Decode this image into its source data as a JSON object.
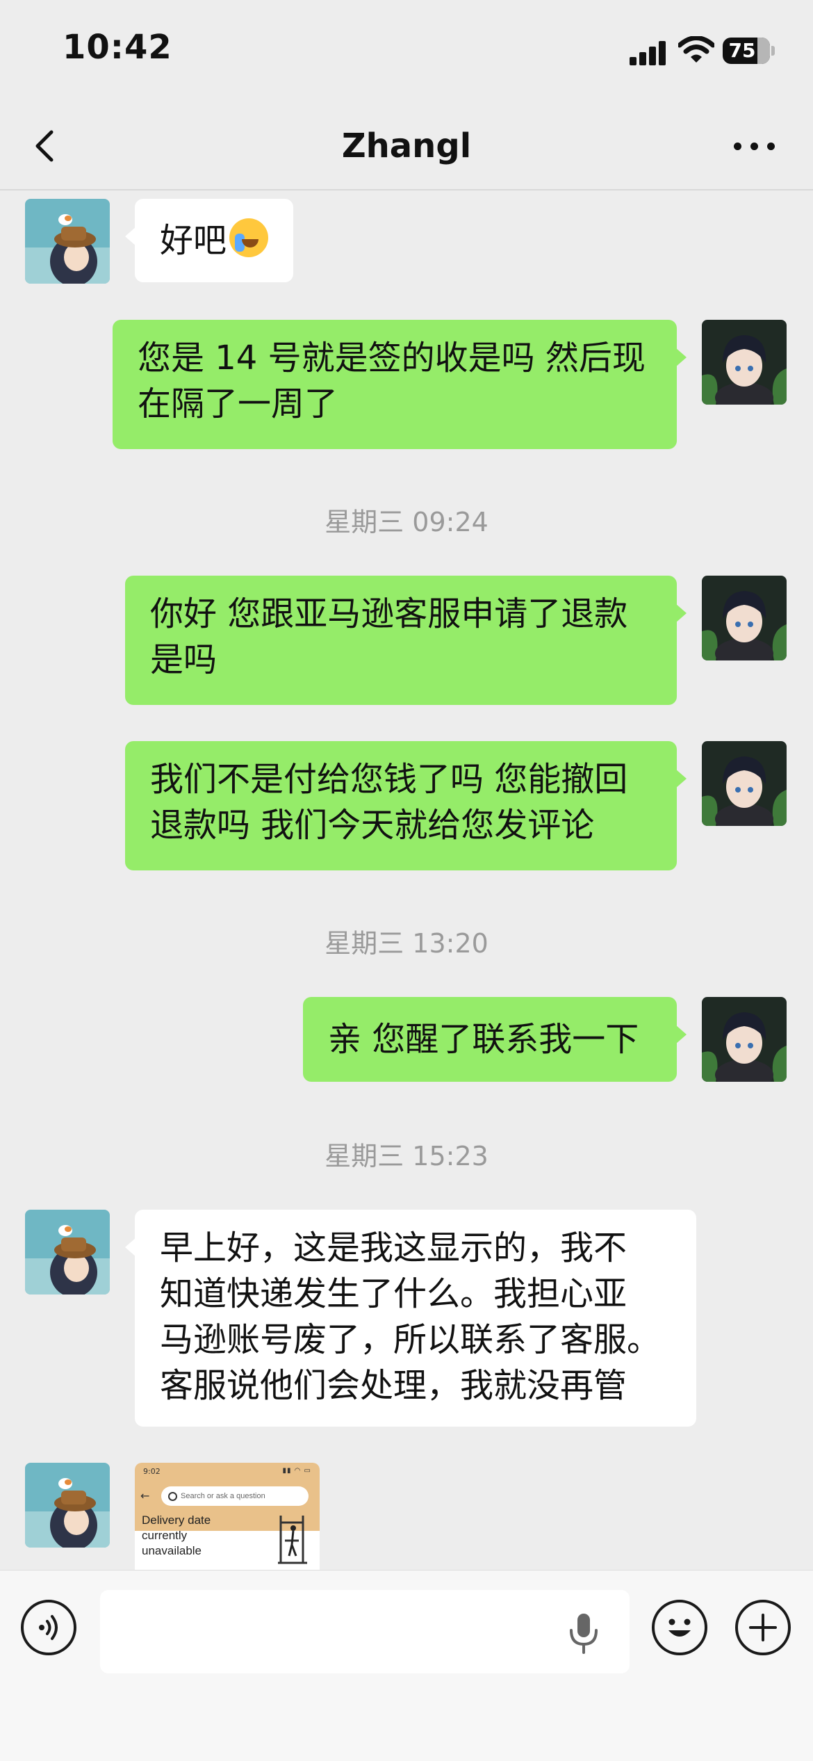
{
  "status_bar": {
    "time": "10:42",
    "battery": "75"
  },
  "nav": {
    "title": "Zhangl"
  },
  "messages": [
    {
      "side": "received",
      "text": "好吧",
      "emoji": "crying-face"
    },
    {
      "side": "sent",
      "lines": [
        "您是 14 号就是签的收是吗 然后现",
        "在隔了一周了"
      ]
    },
    {
      "type": "timestamp",
      "text": "星期三 09:24"
    },
    {
      "side": "sent",
      "lines": [
        "你好 您跟亚马逊客服申请了退款",
        "是吗"
      ]
    },
    {
      "side": "sent",
      "lines": [
        "我们不是付给您钱了吗 您能撤回",
        "退款吗 我们今天就给您发评论"
      ]
    },
    {
      "type": "timestamp",
      "text": "星期三 13:20"
    },
    {
      "side": "sent",
      "lines": [
        "亲 您醒了联系我一下"
      ]
    },
    {
      "type": "timestamp",
      "text": "星期三 15:23"
    },
    {
      "side": "received",
      "lines": [
        "早上好，这是我这显示的，我不",
        "知道快递发生了什么。我担心亚",
        "马逊账号废了，所以联系了客服。",
        "客服说他们会处理，我就没再管"
      ]
    },
    {
      "side": "received",
      "type": "image",
      "screenshot": {
        "time": "9:02",
        "search_placeholder": "Search or ask a question",
        "delivery_lines": [
          "Delivery date",
          "currently",
          "unavailable"
        ]
      }
    }
  ],
  "input": {
    "placeholder": ""
  },
  "colors": {
    "sent_bubble": "#95ec69",
    "received_bubble": "#ffffff",
    "background": "#ededed"
  }
}
